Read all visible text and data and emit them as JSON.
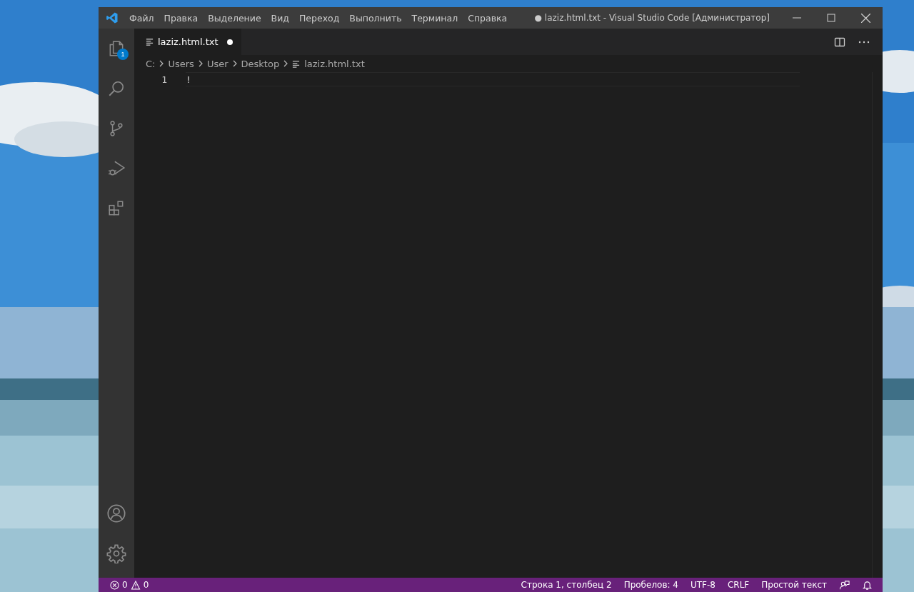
{
  "window": {
    "title": "● laziz.html.txt - Visual Studio Code [Администратор]"
  },
  "menu": [
    "Файл",
    "Правка",
    "Выделение",
    "Вид",
    "Переход",
    "Выполнить",
    "Терминал",
    "Справка"
  ],
  "activity_bar": {
    "top": [
      {
        "kind": "explorer",
        "badge": "1"
      },
      {
        "kind": "search"
      },
      {
        "kind": "source-control"
      },
      {
        "kind": "run-debug"
      },
      {
        "kind": "extensions"
      }
    ],
    "bottom": [
      {
        "kind": "account"
      },
      {
        "kind": "settings"
      }
    ]
  },
  "tabs": [
    {
      "label": "laziz.html.txt",
      "modified": true,
      "selected": true
    }
  ],
  "breadcrumbs": [
    "C:",
    "Users",
    "User",
    "Desktop",
    "laziz.html.txt"
  ],
  "editor": {
    "lines": [
      {
        "number": "1",
        "text": "!"
      }
    ]
  },
  "status_bar": {
    "errors": "0",
    "warnings": "0",
    "right": [
      "Строка 1, столбец 2",
      "Пробелов: 4",
      "UTF-8",
      "CRLF",
      "Простой текст"
    ]
  }
}
